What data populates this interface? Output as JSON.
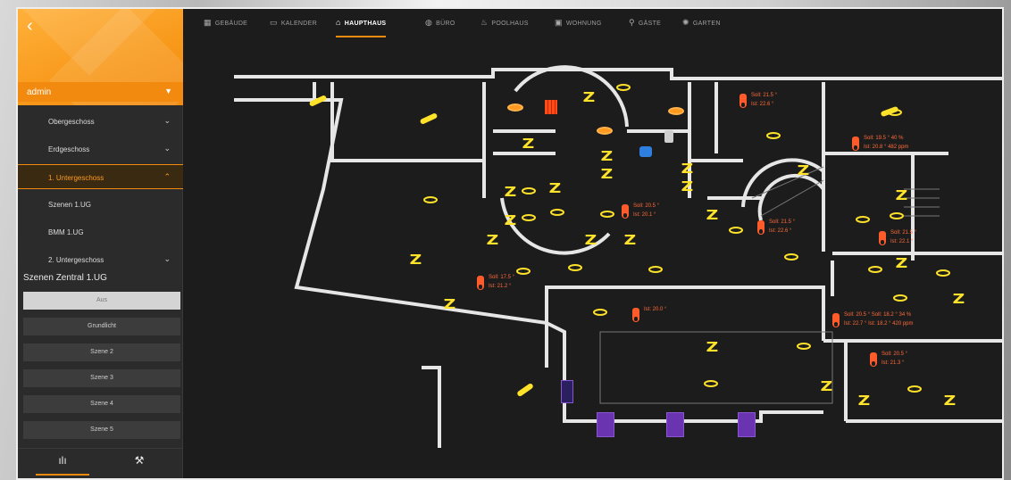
{
  "app": {
    "back_glyph": "‹",
    "user": "admin"
  },
  "sidebar": {
    "items": [
      {
        "label": "Obergeschoss",
        "chevron": "⌄"
      },
      {
        "label": "Erdgeschoss",
        "chevron": "⌄"
      },
      {
        "label": "1. Untergeschoss",
        "chevron": "⌃",
        "active": true
      },
      {
        "label": "Szenen 1.UG",
        "chevron": ""
      },
      {
        "label": "BMM 1.UG",
        "chevron": ""
      },
      {
        "label": "2. Untergeschoss",
        "chevron": "⌄"
      }
    ],
    "scene_title": "Szenen Zentral 1.UG",
    "scenes": [
      "Aus",
      "Grundlicht",
      "Szene 2",
      "Szene 3",
      "Szene 4",
      "Szene 5"
    ],
    "bottom_tabs": [
      {
        "icon": "stats-icon",
        "glyph": "ılı"
      },
      {
        "icon": "tools-icon",
        "glyph": "⚒"
      }
    ]
  },
  "topnav": {
    "tabs": [
      {
        "label": "GEBÄUDE",
        "icon": "building-icon",
        "glyph": "▦"
      },
      {
        "label": "KALENDER",
        "icon": "calendar-icon",
        "glyph": "▭"
      },
      {
        "label": "HAUPTHAUS",
        "icon": "home-icon",
        "glyph": "⌂",
        "active": true
      },
      {
        "label": "BÜRO",
        "icon": "globe-icon",
        "glyph": "◍"
      },
      {
        "label": "POOLHAUS",
        "icon": "pool-icon",
        "glyph": "♨"
      },
      {
        "label": "WOHNUNG",
        "icon": "door-icon",
        "glyph": "▣"
      },
      {
        "label": "GÄSTE",
        "icon": "guest-icon",
        "glyph": "⚲"
      },
      {
        "label": "GARTEN",
        "icon": "garden-icon",
        "glyph": "✺"
      }
    ]
  },
  "thermostats": [
    {
      "line1": "Soll: 21.5 °",
      "line2": "Ist: 22.6 °"
    },
    {
      "line1": "Soll: 19.5 °    40 %",
      "line2": "Ist: 20.8 °  482  ppm"
    },
    {
      "line1": "Soll: 20.5 °",
      "line2": "Ist: 20.1 °"
    },
    {
      "line1": "Soll: 21.5 °",
      "line2": "Ist: 22.6 °"
    },
    {
      "line1": "Soll: 21.5 °",
      "line2": "Ist: 22.1 °"
    },
    {
      "line1": "Soll: 17.5 °",
      "line2": "Ist: 21.2 °"
    },
    {
      "line1": "Ist: 20.0 °",
      "line2": ""
    },
    {
      "line1": "Soll: 20.5 °  Soll: 18.2 °    34 %",
      "line2": "Ist: 22.7 °  Ist: 18.2 °  420  ppm"
    },
    {
      "line1": "Soll: 20.5 °",
      "line2": "Ist: 21.3 °"
    }
  ],
  "colors": {
    "accent": "#f28a10",
    "background": "#1c1c1c",
    "light": "#ffe22a",
    "thermo": "#ff6a3a",
    "shade": "#6a33b0"
  }
}
